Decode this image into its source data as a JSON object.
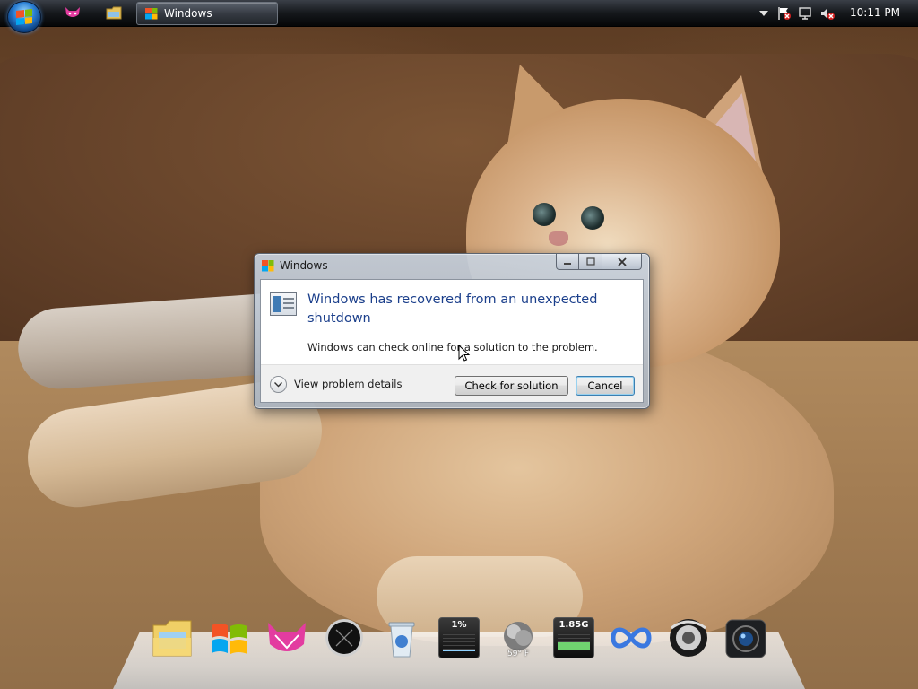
{
  "taskbar": {
    "active_window_label": "Windows",
    "clock": "10:11 PM",
    "quick_launch": [
      "cat-app-icon",
      "folder-icon"
    ],
    "tray_icons": [
      "show-hidden-icons-chevron-icon",
      "action-center-flag-icon",
      "network-icon",
      "volume-muted-icon"
    ]
  },
  "dialog": {
    "title": "Windows",
    "main_instruction": "Windows has recovered from an unexpected shutdown",
    "body": "Windows can check online for a solution to the problem.",
    "details_label": "View problem details",
    "check_button": "Check for solution",
    "cancel_button": "Cancel",
    "caption_buttons": [
      "minimize-icon",
      "maximize-icon",
      "close-icon"
    ]
  },
  "dock": {
    "cpu_label": "1%",
    "cpu_fraction": 0.01,
    "memory_label": "1.85G",
    "memory_fraction": 0.5,
    "weather_temp": "59° F",
    "items": [
      "folder-icon",
      "windows-logo-icon",
      "cat-app-icon",
      "clock-icon",
      "recycle-bin-icon",
      "cpu-meter-icon",
      "weather-icon",
      "memory-meter-icon",
      "infinity-icon",
      "speaker-icon",
      "camera-icon"
    ]
  },
  "colors": {
    "instruction_blue": "#1b3f8b",
    "taskbar_dark": "#15181c",
    "cancel_border": "#3c7fb1"
  }
}
